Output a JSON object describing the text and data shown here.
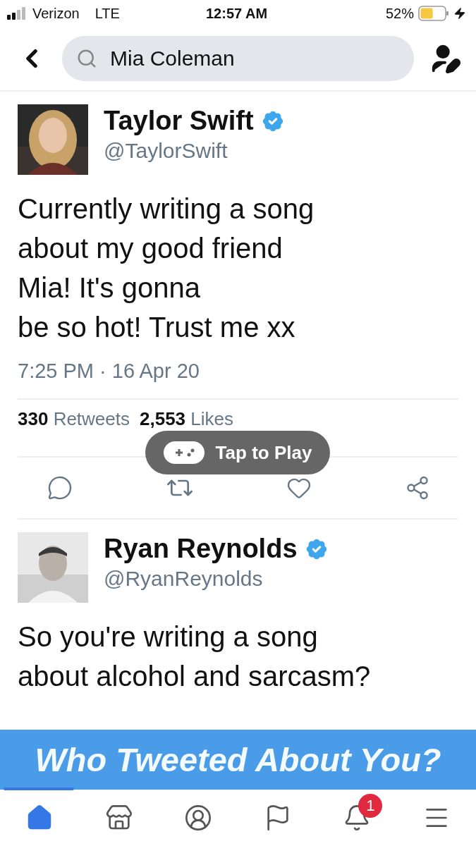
{
  "status_bar": {
    "carrier": "Verizon",
    "network": "LTE",
    "time": "12:57 AM",
    "battery_percent": "52%"
  },
  "search": {
    "value": "Mia Coleman"
  },
  "tweets": [
    {
      "name": "Taylor Swift",
      "handle": "@TaylorSwift",
      "verified": true,
      "text": "Currently writing a song\nabout my good friend\nMia! It's gonna\nbe so hot! Trust me xx",
      "timestamp": "7:25 PM · 16 Apr 20",
      "retweets": "330",
      "retweets_label": "Retweets",
      "likes": "2,553",
      "likes_label": "Likes"
    },
    {
      "name": "Ryan Reynolds",
      "handle": "@RyanReynolds",
      "verified": true,
      "text": "So you're writing a song\nabout alcohol and sarcasm?"
    }
  ],
  "overlay": {
    "label": "Tap to Play"
  },
  "banner": {
    "text": "Who Tweeted About You?"
  },
  "tab_bar": [
    {
      "kind": "home",
      "selected": true
    },
    {
      "kind": "store",
      "selected": false
    },
    {
      "kind": "profile",
      "selected": false
    },
    {
      "kind": "flag",
      "selected": false
    },
    {
      "kind": "bell",
      "selected": false,
      "badge": "1"
    },
    {
      "kind": "menu",
      "selected": false
    }
  ]
}
